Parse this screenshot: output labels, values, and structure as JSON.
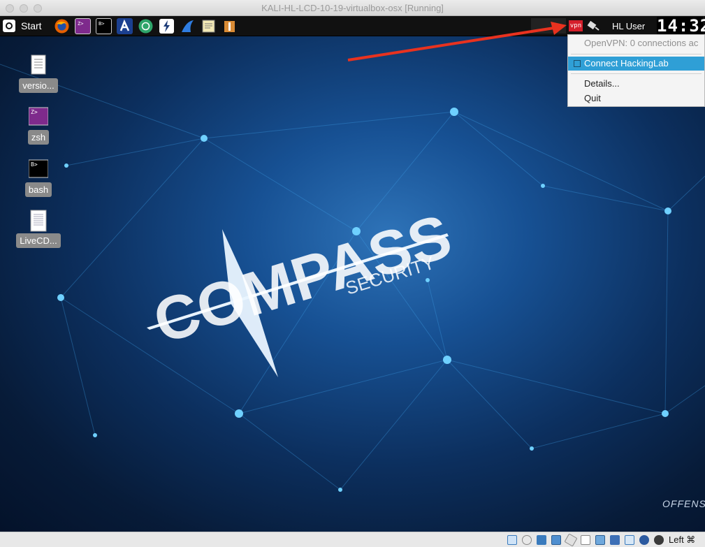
{
  "window": {
    "title": "KALI-HL-LCD-10-19-virtualbox-osx [Running]"
  },
  "taskbar": {
    "start_label": "Start",
    "launchers": [
      "firefox-icon",
      "zsh-terminal-icon",
      "bash-terminal-icon",
      "armitage-icon",
      "maltego-icon",
      "burpsuite-icon",
      "wireshark-icon",
      "text-editor-icon",
      "file-manager-icon"
    ],
    "tray": {
      "vpn_label": "vpn",
      "user_label": "HL User",
      "clock": "14:32"
    }
  },
  "desktop": {
    "icons": [
      {
        "label": "versio...",
        "icon": "text-file-icon"
      },
      {
        "label": "zsh",
        "icon": "zsh-terminal-icon"
      },
      {
        "label": "bash",
        "icon": "bash-terminal-icon"
      },
      {
        "label": "LiveCD...",
        "icon": "document-icon"
      }
    ],
    "wallpaper": {
      "logo_main": "COMPASS",
      "logo_sub": "SECURITY",
      "corner_text": "OFFENS"
    }
  },
  "vpn_menu": {
    "status": "OpenVPN: 0 connections ac",
    "connect": "Connect HackingLab",
    "details": "Details...",
    "quit": "Quit"
  },
  "statusbar": {
    "host_key": "Left ⌘",
    "icons": [
      "optical-drive-icon",
      "audio-icon",
      "network-icon",
      "usb-icon",
      "shared-folders-icon",
      "display-icon",
      "video-capture-icon",
      "cpu-icon",
      "mouse-integration-icon",
      "keyboard-icon"
    ]
  },
  "colors": {
    "menu_highlight": "#2f9fd6",
    "annotation_arrow": "#e8321f",
    "vpn_tray": "#d51f2b"
  }
}
